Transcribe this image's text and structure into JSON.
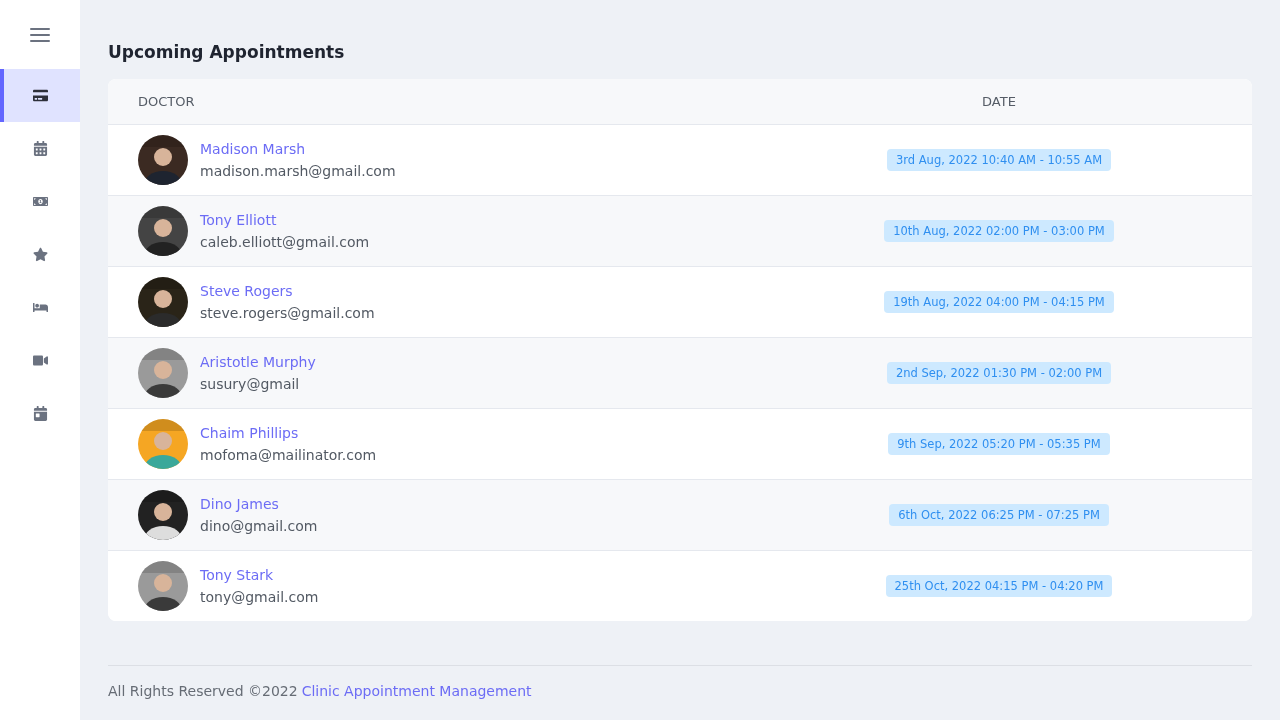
{
  "sidebar": {
    "items": [
      {
        "selected": true
      },
      {
        "selected": false
      },
      {
        "selected": false
      },
      {
        "selected": false
      },
      {
        "selected": false
      },
      {
        "selected": false
      },
      {
        "selected": false
      }
    ]
  },
  "title": "Upcoming Appointments",
  "table": {
    "columns": [
      "DOCTOR",
      "DATE"
    ],
    "rows": [
      {
        "name": "Madison Marsh",
        "email": "madison.marsh@gmail.com",
        "date": "3rd Aug, 2022 10:40 AM - 10:55 AM"
      },
      {
        "name": "Tony Elliott",
        "email": "caleb.elliott@gmail.com",
        "date": "10th Aug, 2022 02:00 PM - 03:00 PM"
      },
      {
        "name": "Steve Rogers",
        "email": "steve.rogers@gmail.com",
        "date": "19th Aug, 2022 04:00 PM - 04:15 PM"
      },
      {
        "name": "Aristotle Murphy",
        "email": "susury@gmail",
        "date": "2nd Sep, 2022 01:30 PM - 02:00 PM"
      },
      {
        "name": "Chaim Phillips",
        "email": "mofoma@mailinator.com",
        "date": "9th Sep, 2022 05:20 PM - 05:35 PM"
      },
      {
        "name": "Dino James",
        "email": "dino@gmail.com",
        "date": "6th Oct, 2022 06:25 PM - 07:25 PM"
      },
      {
        "name": "Tony Stark",
        "email": "tony@gmail.com",
        "date": "25th Oct, 2022 04:15 PM - 04:20 PM"
      }
    ]
  },
  "footer": {
    "text": "All Rights Reserved ©2022",
    "link": "Clinic Appointment Management"
  }
}
